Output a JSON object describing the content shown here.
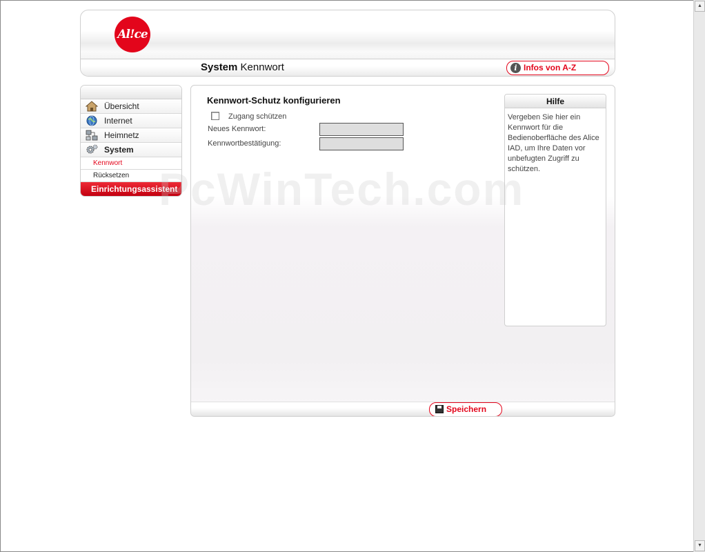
{
  "header": {
    "logo_text": "Al!ce",
    "title_bold": "System",
    "title_rest": "Kennwort",
    "info_button_label": "Infos von A-Z"
  },
  "sidebar": {
    "items": [
      {
        "label": "Übersicht",
        "icon": "home-icon"
      },
      {
        "label": "Internet",
        "icon": "globe-icon"
      },
      {
        "label": "Heimnetz",
        "icon": "network-icon"
      },
      {
        "label": "System",
        "icon": "gear-icon"
      }
    ],
    "subitems": [
      {
        "label": "Kennwort"
      },
      {
        "label": "Rücksetzen"
      }
    ],
    "wizard_label": "Einrichtungsassistent"
  },
  "main": {
    "section_title": "Kennwort-Schutz konfigurieren",
    "protect_checkbox_label": "Zugang schützen",
    "new_password_label": "Neues Kennwort:",
    "confirm_password_label": "Kennwortbestätigung:",
    "new_password_value": "",
    "confirm_password_value": "",
    "save_label": "Speichern"
  },
  "help": {
    "title": "Hilfe",
    "text": "Vergeben Sie hier ein Kennwort für die Bedienoberfläche des Alice IAD, um Ihre Daten vor unbefugten Zugriff zu schützen."
  },
  "watermark": "PcWinTech.com",
  "colors": {
    "brand_red": "#e3051b"
  }
}
